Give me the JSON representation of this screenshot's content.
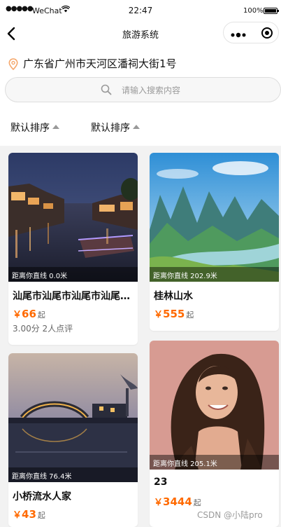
{
  "status_bar": {
    "signal": "●●●●●",
    "carrier": "WeChat",
    "time": "22:47",
    "battery": "100%"
  },
  "nav": {
    "title": "旅游系统"
  },
  "location": {
    "address": "广东省广州市天河区潘祠大街1号",
    "icon": "location-pin-icon",
    "icon_color": "#f5a76b"
  },
  "search": {
    "placeholder": "请输入搜索内容"
  },
  "sort": [
    {
      "label": "默认排序"
    },
    {
      "label": "默认排序"
    }
  ],
  "colors": {
    "price": "#ff6a00",
    "page_background": "#f2f2f2"
  },
  "cards": [
    {
      "distance": "距离你直线 0.0米",
      "name": "汕尾市汕尾市汕尾市汕尾市汕尾市",
      "currency": "￥",
      "price": "66",
      "price_suffix": "起",
      "rating": "3.00分 2人点评"
    },
    {
      "distance": "距离你直线 202.9米",
      "name": "桂林山水",
      "currency": "￥",
      "price": "555",
      "price_suffix": "起"
    },
    {
      "distance": "距离你直线 76.4米",
      "name": "小桥流水人家",
      "currency": "￥",
      "price": "43",
      "price_suffix": "起"
    },
    {
      "distance": "距离你直线 205.1米",
      "name": "23",
      "currency": "￥",
      "price": "3444",
      "price_suffix": "起"
    }
  ],
  "watermark": "CSDN @小陆pro"
}
